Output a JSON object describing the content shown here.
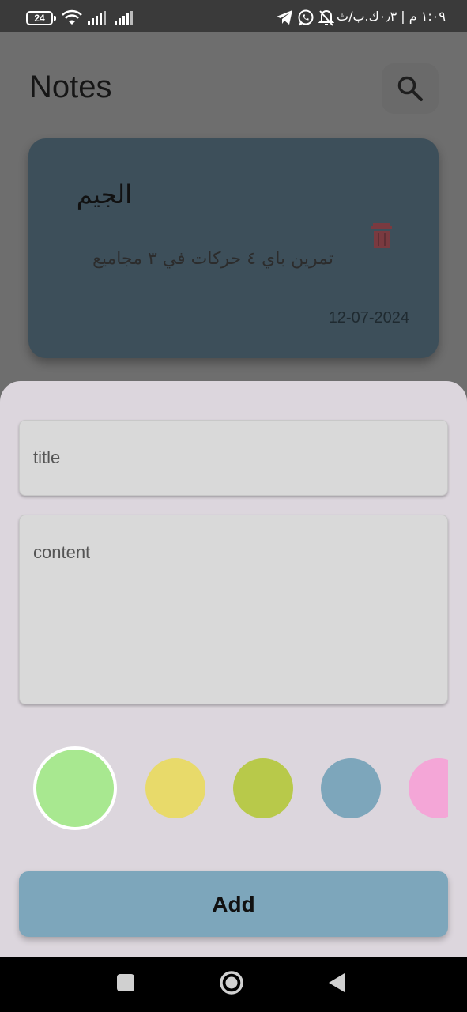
{
  "status_bar": {
    "battery": "24",
    "right_text": "١:٠٩ م | ٠٫٣ك.ب/ث",
    "icons": [
      "wifi-icon",
      "signal-icon",
      "signal-icon",
      "telegram-icon",
      "whatsapp-icon",
      "bell-off-icon"
    ]
  },
  "app": {
    "title": "Notes",
    "search_icon": "search-icon"
  },
  "note": {
    "title": "الجيم",
    "content": "تمرين باي  ٤ حركات في ٣ مجاميع",
    "date": "12-07-2024",
    "delete_icon": "trash-icon",
    "color": "#3d4f5a"
  },
  "sheet": {
    "title_placeholder": "title",
    "content_placeholder": "content",
    "colors": [
      "#a8e890",
      "#e8da6a",
      "#b8c94a",
      "#7da6bb",
      "#f4a6d7"
    ],
    "selected_color_index": 0,
    "add_label": "Add"
  },
  "nav": {
    "icons": [
      "recent-apps-icon",
      "home-icon",
      "back-icon"
    ]
  }
}
